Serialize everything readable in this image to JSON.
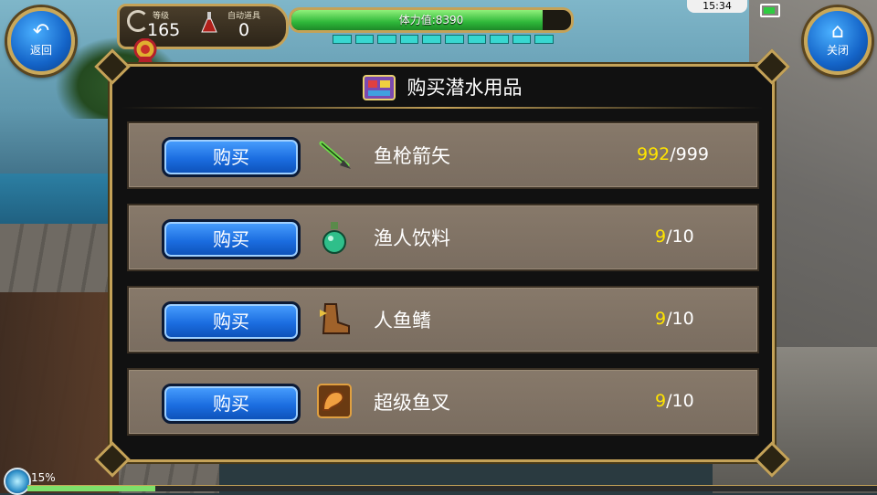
{
  "hud": {
    "back_label": "返回",
    "close_label": "关闭",
    "level_tag": "等级",
    "level_value": "165",
    "auto_tag": "自动道具",
    "auto_value": "0",
    "stamina_text": "体力值:8390",
    "stamina_fraction": 0.9,
    "segments_filled": 10,
    "clock": "15:34"
  },
  "panel": {
    "title": "购买潜水用品",
    "items": [
      {
        "buy_label": "购买",
        "name": "鱼枪箭矢",
        "icon": "spear-arrow-icon",
        "current": "992",
        "max": "/999"
      },
      {
        "buy_label": "购买",
        "name": "渔人饮料",
        "icon": "potion-bottle-icon",
        "current": "9",
        "max": "/10"
      },
      {
        "buy_label": "购买",
        "name": "人鱼鳍",
        "icon": "fin-boot-icon",
        "current": "9",
        "max": "/10"
      },
      {
        "buy_label": "购买",
        "name": "超级鱼叉",
        "icon": "muscle-arm-icon",
        "current": "9",
        "max": "/10"
      }
    ]
  },
  "footer": {
    "exp_text": "15%",
    "exp_fraction": 0.15
  },
  "colors": {
    "accent_gold": "#c4a258",
    "count_yellow": "#ffe400",
    "button_blue": "#1b6de0"
  }
}
